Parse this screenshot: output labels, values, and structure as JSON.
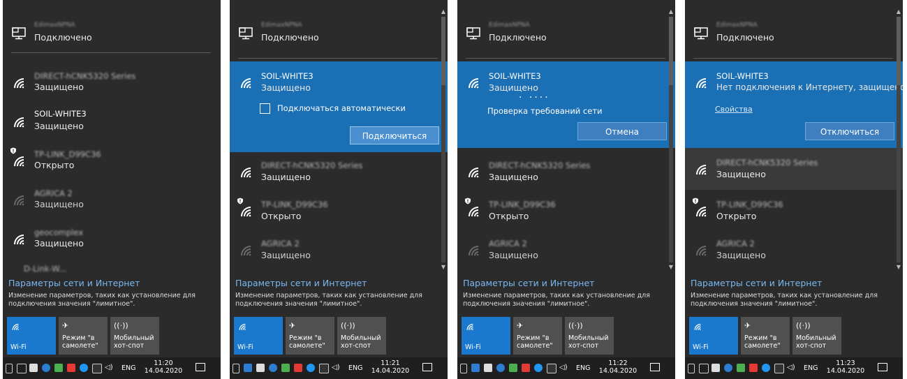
{
  "connected": {
    "name_blurred": "EdimaxNPNA",
    "status": "Подключено"
  },
  "networks": {
    "direct": "DIRECT-hCNK5320 Series",
    "soil": "SOIL-WHITE3",
    "tplink": "TP-LINK_D99C36",
    "agrega": "AGRICA 2",
    "geo": "geocomplex",
    "more": "D-Link-W..."
  },
  "status": {
    "secured": "Защищено",
    "open": "Открыто",
    "no_internet_secured": "Нет подключения к Интернету, защищено",
    "checking": "Проверка требований сети"
  },
  "actions": {
    "auto_connect": "Подключаться автоматически",
    "connect": "Подключиться",
    "cancel": "Отмена",
    "disconnect": "Отключиться",
    "properties": "Свойства"
  },
  "settings": {
    "title": "Параметры сети и Интернет",
    "description": "Изменение параметров, таких как установление для подключения значения \"лимитное\"."
  },
  "tiles": {
    "wifi": "Wi-Fi",
    "airplane_line1": "Режим \"в",
    "airplane_line2": "самолете\"",
    "hotspot_line1": "Мобильный",
    "hotspot_line2": "хот-спот"
  },
  "taskbar": {
    "lang": "ENG",
    "date": "14.04.2020",
    "times": [
      "11:20",
      "11:21",
      "11:22",
      "11:23"
    ]
  },
  "colors": {
    "accent": "#1a6fb5",
    "panel_bg": "#2b2b2b",
    "link": "#7ab8f0"
  }
}
